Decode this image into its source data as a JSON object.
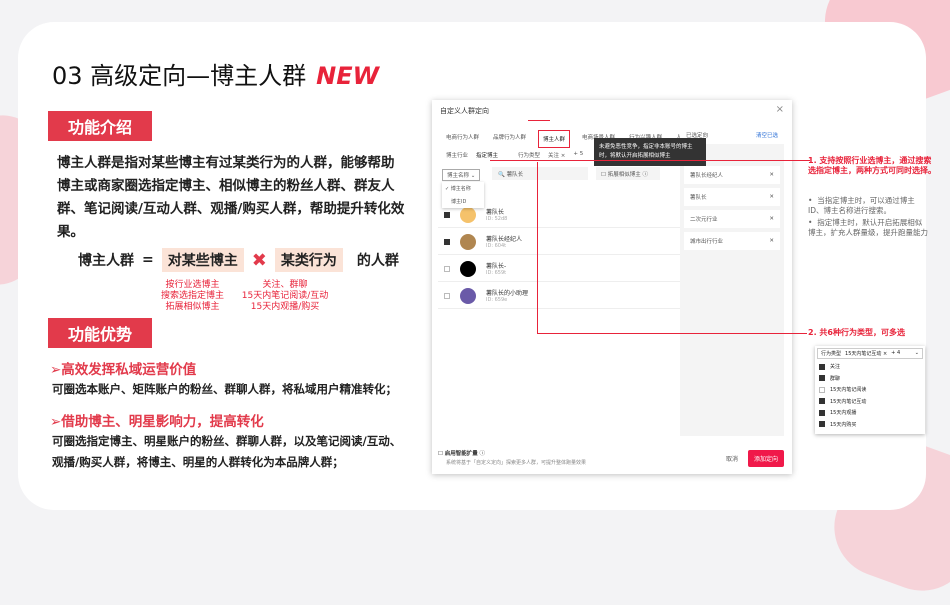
{
  "slide": {
    "title": "03  高级定向—博主人群",
    "badge": "NEW"
  },
  "intro": {
    "tag": "功能介绍",
    "text": "博主人群是指对某些博主有过某类行为的人群，能够帮助博主或商家圈选指定博主、相似博主的粉丝人群、群友人群、笔记阅读/互动人群、观播/购买人群，帮助提升转化效果。"
  },
  "formula": {
    "lhs": "博主人群",
    "eq": "=",
    "a": "对某些博主",
    "x": "✖",
    "b": "某类行为",
    "suffix": "的人群",
    "a_notes": [
      "按行业选博主",
      "搜索选指定博主",
      "拓展相似博主"
    ],
    "b_notes": [
      "关注、群聊",
      "15天内笔记阅读/互动",
      "15天内观播/购买"
    ]
  },
  "advantages": {
    "tag": "功能优势",
    "items": [
      {
        "head": "➢高效发挥私域运营价值",
        "text": "可圈选本账户、矩阵账户的粉丝、群聊人群，将私域用户精准转化；"
      },
      {
        "head": "➢借助博主、明星影响力，提高转化",
        "text": "可圈选指定博主、明星账户的粉丝、群聊人群，以及笔记阅读/互动、观播/购买人群，将博主、明星的人群转化为本品牌人群；"
      }
    ]
  },
  "modal": {
    "title": "自定义人群定向",
    "close": "×",
    "tabs": [
      "电商行为人群",
      "品牌行为人群",
      "博主人群",
      "电商场景人群",
      "行为兴趣人群",
      "人群包"
    ],
    "subtabs": [
      "博主行业",
      "指定博主"
    ],
    "behavior_label": "行为类型",
    "behavior_value": "关注 ×",
    "behavior_more": "+ 5",
    "search_type": "博主名称",
    "search_value": "薯队长",
    "expand_label": "拓展相似博主",
    "dropdown": [
      "博主名称",
      "博主ID"
    ],
    "tooltip": "未避免恶性竞争，指定非本账号的博主时，将默认开启拓展相似博主",
    "rows": [
      {
        "name": "薯队长",
        "id": "ID: 52d8",
        "checked": true,
        "color": "#f5c26b"
      },
      {
        "name": "薯队长经纪人",
        "id": "ID: 604t",
        "checked": true,
        "color": "#b08650"
      },
      {
        "name": "薯队长-",
        "id": "ID: 659t",
        "checked": false,
        "color": "#000000"
      },
      {
        "name": "薯队长的小助理",
        "id": "ID: 659e",
        "checked": false,
        "color": "#6a5aa8"
      }
    ],
    "selected_title": "已选定向",
    "clear": "清空已选",
    "selected": [
      "薯队长经纪人",
      "薯队长",
      "二次元行业",
      "城市出行行业"
    ],
    "smart_label": "启用智能扩量",
    "smart_desc": "系统将基于「自定义定向」探索更多人群，可提升整体跑量效果",
    "cancel": "取消",
    "confirm": "添加定向"
  },
  "annotations": {
    "a1": "1. 支持按照行业选博主，通过搜索选指定博主，两种方式可同时选择。",
    "bullets": [
      "当指定博主时，可以通过博主ID、博主名称进行搜索。",
      "指定博主时，默认开启拓展相似博主，扩充人群量级，提升跑量能力"
    ],
    "a2": "2. 共6种行为类型，可多选",
    "dd_label": "行为类型",
    "dd_value": "15天内笔记互动 ×",
    "dd_more": "+ 4",
    "dd_items": [
      {
        "label": "关注",
        "checked": true
      },
      {
        "label": "群聊",
        "checked": true
      },
      {
        "label": "15天内笔记阅读",
        "checked": false
      },
      {
        "label": "15天内笔记互动",
        "checked": true
      },
      {
        "label": "15天内观播",
        "checked": true
      },
      {
        "label": "15天内购买",
        "checked": true
      }
    ]
  },
  "colors": {
    "accent": "#e8233a"
  }
}
